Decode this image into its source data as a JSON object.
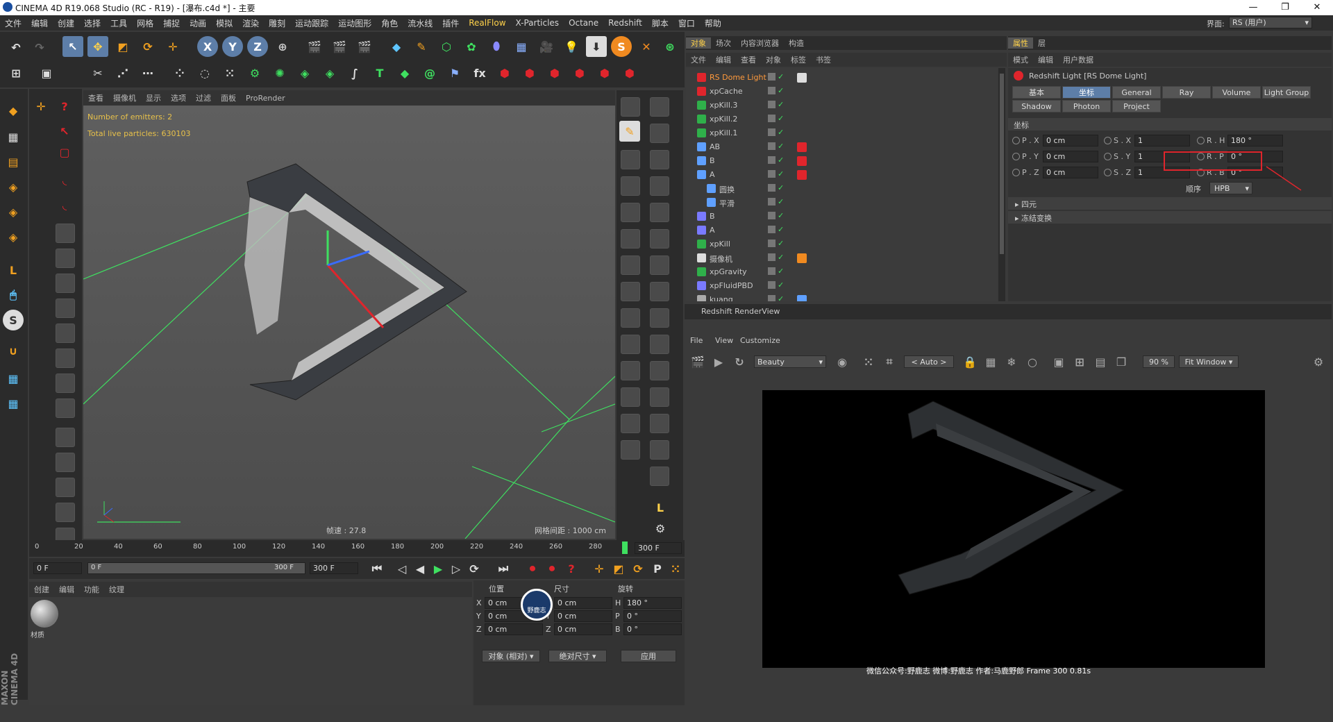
{
  "window": {
    "title": "CINEMA 4D R19.068 Studio (RC - R19) - [瀑布.c4d *] - 主要",
    "minimize": "—",
    "maximize": "❐",
    "close": "✕"
  },
  "menu": [
    "文件",
    "编辑",
    "创建",
    "选择",
    "工具",
    "网格",
    "捕捉",
    "动画",
    "模拟",
    "渲染",
    "雕刻",
    "运动跟踪",
    "运动图形",
    "角色",
    "流水线",
    "插件",
    "RealFlow",
    "X-Particles",
    "Octane",
    "Redshift",
    "脚本",
    "窗口",
    "帮助"
  ],
  "layout": {
    "label": "界面:",
    "value": "RS (用户)"
  },
  "viewport": {
    "menu": [
      "查看",
      "摄像机",
      "显示",
      "选项",
      "过滤",
      "面板",
      "ProRender"
    ],
    "hud_emitters": "Number of emitters: 2",
    "hud_particles": "Total live particles: 630103",
    "speed": "帧速 : 27.8",
    "grid": "网格间距 : 1000 cm"
  },
  "timeline": {
    "ticks": [
      "0",
      "20",
      "40",
      "60",
      "80",
      "100",
      "120",
      "140",
      "160",
      "180",
      "200",
      "220",
      "240",
      "260",
      "280"
    ],
    "current_frame_label": "300 F",
    "start": "0 F",
    "slider_start": "0 F",
    "slider_end": "300 F",
    "end": "300 F",
    "progress": 1.0
  },
  "material_panel": {
    "menu": [
      "创建",
      "编辑",
      "功能",
      "纹理"
    ],
    "material_name": "材质"
  },
  "coord_panel": {
    "headers": [
      "位置",
      "尺寸",
      "旋转"
    ],
    "rows": [
      {
        "axis": "X",
        "pos": "0 cm",
        "size_axis": "X",
        "size": "0 cm",
        "rot_axis": "H",
        "rot": "180 °"
      },
      {
        "axis": "Y",
        "pos": "0 cm",
        "size_axis": "Y",
        "size": "0 cm",
        "rot_axis": "P",
        "rot": "0 °"
      },
      {
        "axis": "Z",
        "pos": "0 cm",
        "size_axis": "Z",
        "size": "0 cm",
        "rot_axis": "B",
        "rot": "0 °"
      }
    ],
    "mode": "对象 (相对)",
    "size_mode": "绝对尺寸",
    "apply": "应用",
    "badge": "野鹿志"
  },
  "object_manager": {
    "tabs": [
      "对象",
      "场次",
      "内容浏览器",
      "构造"
    ],
    "menu": [
      "文件",
      "编辑",
      "查看",
      "对象",
      "标签",
      "书签"
    ],
    "objects": [
      {
        "name": "RS Dome Light",
        "color": "#ff9a3c",
        "icon": "dome-light-icon",
        "indent": 0,
        "tag": "sky"
      },
      {
        "name": "xpCache",
        "color": "#c8c8c8",
        "icon": "xp-cache-icon",
        "indent": 0,
        "tag": ""
      },
      {
        "name": "xpKill.3",
        "color": "#c8c8c8",
        "icon": "xp-kill-icon",
        "indent": 0,
        "tag": ""
      },
      {
        "name": "xpKill.2",
        "color": "#c8c8c8",
        "icon": "xp-kill-icon",
        "indent": 0,
        "tag": ""
      },
      {
        "name": "xpKill.1",
        "color": "#c8c8c8",
        "icon": "xp-kill-icon",
        "indent": 0,
        "tag": ""
      },
      {
        "name": "AB",
        "color": "#c8c8c8",
        "icon": "null-icon",
        "indent": 0,
        "tag": "red"
      },
      {
        "name": "B",
        "color": "#c8c8c8",
        "icon": "null-icon",
        "indent": 0,
        "tag": "red"
      },
      {
        "name": "A",
        "color": "#c8c8c8",
        "icon": "null-icon",
        "indent": 0,
        "tag": "red"
      },
      {
        "name": "圆换",
        "color": "#c8c8c8",
        "icon": "subdivision-icon",
        "indent": 1,
        "tag": ""
      },
      {
        "name": "平滑",
        "color": "#c8c8c8",
        "icon": "smooth-icon",
        "indent": 1,
        "tag": ""
      },
      {
        "name": "B",
        "color": "#c8c8c8",
        "icon": "emitter-icon",
        "indent": 0,
        "tag": ""
      },
      {
        "name": "A",
        "color": "#c8c8c8",
        "icon": "emitter-icon",
        "indent": 0,
        "tag": ""
      },
      {
        "name": "xpKill",
        "color": "#c8c8c8",
        "icon": "xp-kill-icon",
        "indent": 0,
        "tag": ""
      },
      {
        "name": "摄像机",
        "color": "#c8c8c8",
        "icon": "camera-icon",
        "indent": 0,
        "tag": "cam"
      },
      {
        "name": "xpGravity",
        "color": "#c8c8c8",
        "icon": "xp-gravity-icon",
        "indent": 0,
        "tag": ""
      },
      {
        "name": "xpFluidPBD",
        "color": "#c8c8c8",
        "icon": "xp-fluid-icon",
        "indent": 0,
        "tag": ""
      },
      {
        "name": "kuang",
        "color": "#c8c8c8",
        "icon": "figure-icon",
        "indent": 0,
        "tag": "multi"
      }
    ]
  },
  "attributes": {
    "tabs": [
      "属性",
      "层"
    ],
    "menu": [
      "模式",
      "编辑",
      "用户数据"
    ],
    "object_title": "Redshift Light [RS Dome Light]",
    "subtabs_row1": [
      "基本",
      "坐标",
      "General",
      "Ray",
      "Volume",
      "Light Group"
    ],
    "subtabs_row2": [
      "Shadow",
      "Photon",
      "Project"
    ],
    "active_subtab": "坐标",
    "section": "坐标",
    "fields": [
      {
        "p_label": "P . X",
        "p": "0 cm",
        "s_label": "S . X",
        "s": "1",
        "r_label": "R . H",
        "r": "180 °"
      },
      {
        "p_label": "P . Y",
        "p": "0 cm",
        "s_label": "S . Y",
        "s": "1",
        "r_label": "R . P",
        "r": "0 °"
      },
      {
        "p_label": "P . Z",
        "p": "0 cm",
        "s_label": "S . Z",
        "s": "1",
        "r_label": "R . B",
        "r": "0 °"
      }
    ],
    "order_label": "顺序",
    "order": "HPB",
    "groups": [
      "四元",
      "冻结变换"
    ]
  },
  "renderview": {
    "title": "Redshift RenderView",
    "menu": [
      "File",
      "View",
      "Customize"
    ],
    "aov": "Beauty",
    "auto": "< Auto >",
    "zoom": "90 %",
    "fit": "Fit Window",
    "footer": "微信公众号:野鹿志  微博:野鹿志  作者:马鹿野郎  Frame  300  0.81s"
  },
  "colors": {
    "accent": "#5d7ea8",
    "highlight_box": "#e0252c",
    "grid_green": "#3fe060",
    "hud_yellow": "#e8c14a"
  }
}
